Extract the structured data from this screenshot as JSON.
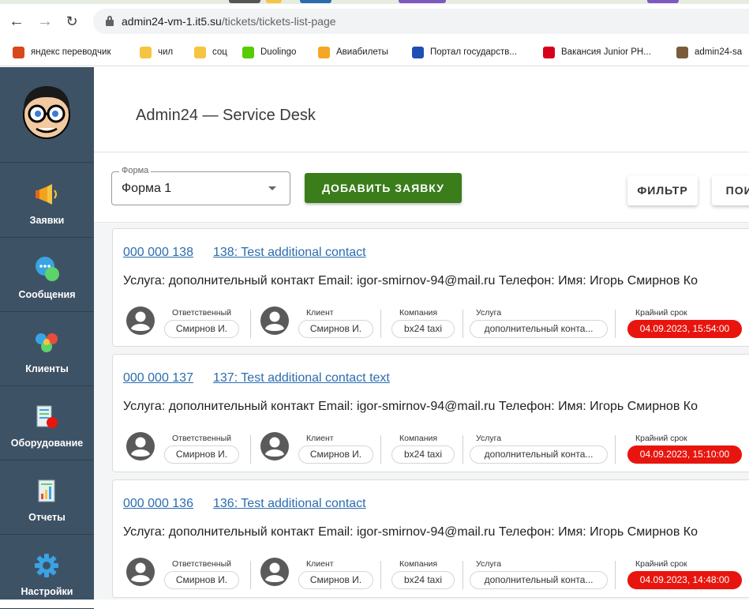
{
  "browser": {
    "url_host": "admin24-vm-1.it5.su",
    "url_path": "/tickets/tickets-list-page",
    "bookmarks": [
      {
        "label": "яндекс переводчик",
        "color": "#d9481a"
      },
      {
        "label": "чил",
        "color": "#f5c542"
      },
      {
        "label": "соц",
        "color": "#f5c542"
      },
      {
        "label": "Duolingo",
        "color": "#58cc02"
      },
      {
        "label": "Авиабилеты",
        "color": "#f5a623"
      },
      {
        "label": "Портал государств...",
        "color": "#1e4fb5"
      },
      {
        "label": "Вакансия Junior PH...",
        "color": "#d6001c"
      },
      {
        "label": "admin24-sa",
        "color": "#7a5c3a"
      }
    ]
  },
  "sidebar": {
    "items": [
      {
        "label": "Заявки",
        "icon": "megaphone-icon"
      },
      {
        "label": "Сообщения",
        "icon": "chat-bubbles-icon"
      },
      {
        "label": "Клиенты",
        "icon": "clients-icon"
      },
      {
        "label": "Оборудование",
        "icon": "equipment-icon"
      },
      {
        "label": "Отчеты",
        "icon": "report-icon"
      },
      {
        "label": "Настройки",
        "icon": "gear-icon"
      }
    ]
  },
  "header": {
    "title": "Admin24 — Service Desk"
  },
  "toolbar": {
    "form_legend": "Форма",
    "form_value": "Форма 1",
    "add_label": "ДОБАВИТЬ ЗАЯВКУ",
    "filter_label": "ФИЛЬТР",
    "search_label": "ПОИСК"
  },
  "field_labels": {
    "responsible": "Ответственный",
    "client": "Клиент",
    "company": "Компания",
    "service": "Услуга",
    "deadline": "Крайний срок"
  },
  "tickets": [
    {
      "number": "000 000 138",
      "title": "138: Test additional contact",
      "description": "Услуга: дополнительный контакт Email: igor-smirnov-94@mail.ru Телефон: Имя: Игорь Смирнов Ко",
      "responsible": "Смирнов И.",
      "client": "Смирнов И.",
      "company": "bx24 taxi",
      "service": "дополнительный конта...",
      "deadline": "04.09.2023, 15:54:00"
    },
    {
      "number": "000 000 137",
      "title": "137: Test additional contact text",
      "description": "Услуга: дополнительный контакт Email: igor-smirnov-94@mail.ru Телефон: Имя: Игорь Смирнов Ко",
      "responsible": "Смирнов И.",
      "client": "Смирнов И.",
      "company": "bx24 taxi",
      "service": "дополнительный конта...",
      "deadline": "04.09.2023, 15:10:00"
    },
    {
      "number": "000 000 136",
      "title": "136: Test additional contact",
      "description": "Услуга: дополнительный контакт Email: igor-smirnov-94@mail.ru Телефон: Имя: Игорь Смирнов Ко",
      "responsible": "Смирнов И.",
      "client": "Смирнов И.",
      "company": "bx24 taxi",
      "service": "дополнительный конта...",
      "deadline": "04.09.2023, 14:48:00"
    }
  ]
}
